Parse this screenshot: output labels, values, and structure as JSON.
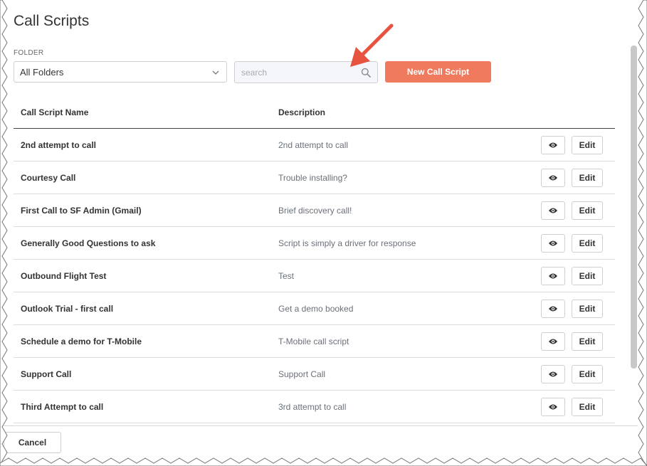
{
  "page": {
    "title": "Call Scripts"
  },
  "filters": {
    "folder_label": "FOLDER",
    "folder_selected": "All Folders",
    "search_placeholder": "search",
    "search_value": "",
    "new_button_label": "New Call Script"
  },
  "table": {
    "headers": [
      "Call Script Name",
      "Description"
    ],
    "edit_label": "Edit",
    "rows": [
      {
        "name": "2nd attempt to call",
        "description": "2nd attempt to call"
      },
      {
        "name": "Courtesy Call",
        "description": "Trouble installing?"
      },
      {
        "name": "First Call to SF Admin (Gmail)",
        "description": "Brief discovery call!"
      },
      {
        "name": "Generally Good Questions to ask",
        "description": "Script is simply a driver for response"
      },
      {
        "name": "Outbound Flight Test",
        "description": "Test"
      },
      {
        "name": "Outlook Trial - first call",
        "description": "Get a demo booked"
      },
      {
        "name": "Schedule a demo for T-Mobile",
        "description": "T-Mobile call script"
      },
      {
        "name": "Support Call",
        "description": "Support Call"
      },
      {
        "name": "Third Attempt to call",
        "description": "3rd attempt to call"
      }
    ]
  },
  "footer": {
    "cancel_label": "Cancel"
  },
  "icons": {
    "view": "eye-icon",
    "search": "search-icon",
    "dropdown": "chevron-down-icon",
    "annotation": "arrow-icon"
  },
  "colors": {
    "accent": "#f07a5e",
    "annotation_arrow": "#e8533f"
  }
}
